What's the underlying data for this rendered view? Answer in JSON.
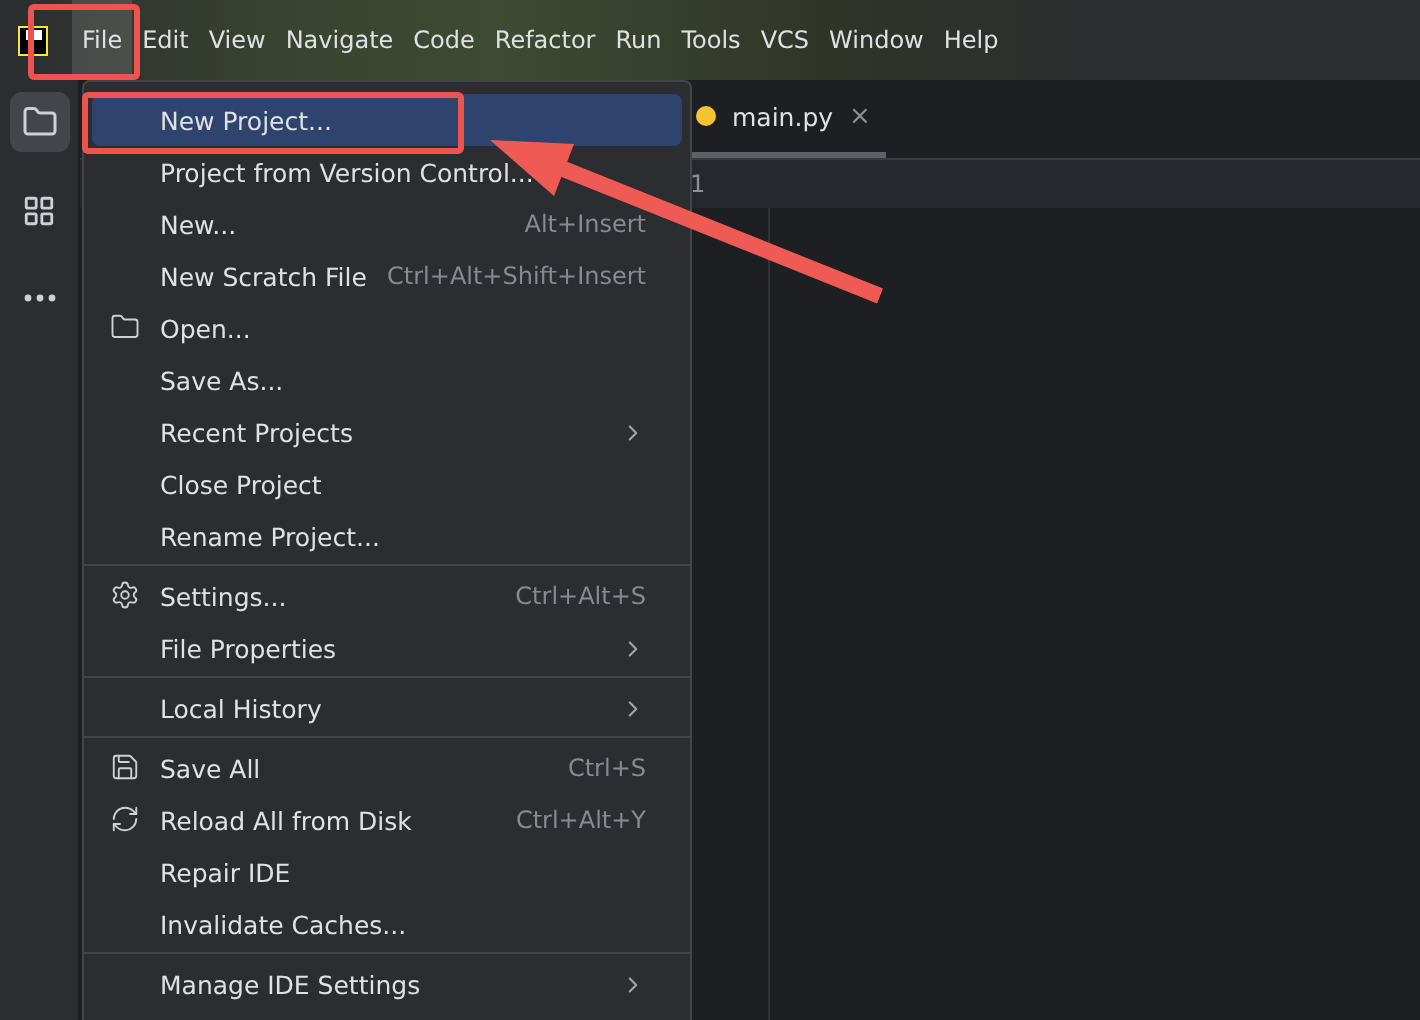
{
  "menubar": [
    {
      "label": "File",
      "selected": true,
      "highlighted": true
    },
    {
      "label": "Edit",
      "selected": false,
      "highlighted": false
    },
    {
      "label": "View",
      "selected": false,
      "highlighted": false
    },
    {
      "label": "Navigate",
      "selected": false,
      "highlighted": false
    },
    {
      "label": "Code",
      "selected": false,
      "highlighted": false
    },
    {
      "label": "Refactor",
      "selected": false,
      "highlighted": false
    },
    {
      "label": "Run",
      "selected": false,
      "highlighted": false
    },
    {
      "label": "Tools",
      "selected": false,
      "highlighted": false
    },
    {
      "label": "VCS",
      "selected": false,
      "highlighted": false
    },
    {
      "label": "Window",
      "selected": false,
      "highlighted": false
    },
    {
      "label": "Help",
      "selected": false,
      "highlighted": false
    }
  ],
  "editor": {
    "tab": {
      "label": "main.py",
      "close": "×"
    },
    "line_numbers": [
      "1"
    ]
  },
  "file_menu": [
    {
      "kind": "item",
      "label": "New Project...",
      "selected": true,
      "highlighted": true
    },
    {
      "kind": "item",
      "label": "Project from Version Control...",
      "selected": false
    },
    {
      "kind": "item",
      "label": "New...",
      "shortcut": "Alt+Insert",
      "selected": false
    },
    {
      "kind": "item",
      "label": "New Scratch File",
      "shortcut": "Ctrl+Alt+Shift+Insert",
      "selected": false
    },
    {
      "kind": "item",
      "label": "Open...",
      "icon": true,
      "selected": false
    },
    {
      "kind": "item",
      "label": "Save As...",
      "selected": false
    },
    {
      "kind": "submenu",
      "label": "Recent Projects",
      "selected": false
    },
    {
      "kind": "item",
      "label": "Close Project",
      "selected": false
    },
    {
      "kind": "item",
      "label": "Rename Project...",
      "selected": false
    },
    {
      "kind": "separator"
    },
    {
      "kind": "item",
      "label": "Settings...",
      "shortcut": "Ctrl+Alt+S",
      "icon": true,
      "selected": false
    },
    {
      "kind": "submenu",
      "label": "File Properties",
      "selected": false
    },
    {
      "kind": "separator"
    },
    {
      "kind": "submenu",
      "label": "Local History",
      "selected": false
    },
    {
      "kind": "separator"
    },
    {
      "kind": "item",
      "label": "Save All",
      "shortcut": "Ctrl+S",
      "icon": true,
      "selected": false
    },
    {
      "kind": "item",
      "label": "Reload All from Disk",
      "shortcut": "Ctrl+Alt+Y",
      "icon": true,
      "selected": false
    },
    {
      "kind": "item",
      "label": "Repair IDE",
      "selected": false
    },
    {
      "kind": "item",
      "label": "Invalidate Caches...",
      "selected": false
    },
    {
      "kind": "separator"
    },
    {
      "kind": "submenu",
      "label": "Manage IDE Settings",
      "selected": false
    }
  ]
}
